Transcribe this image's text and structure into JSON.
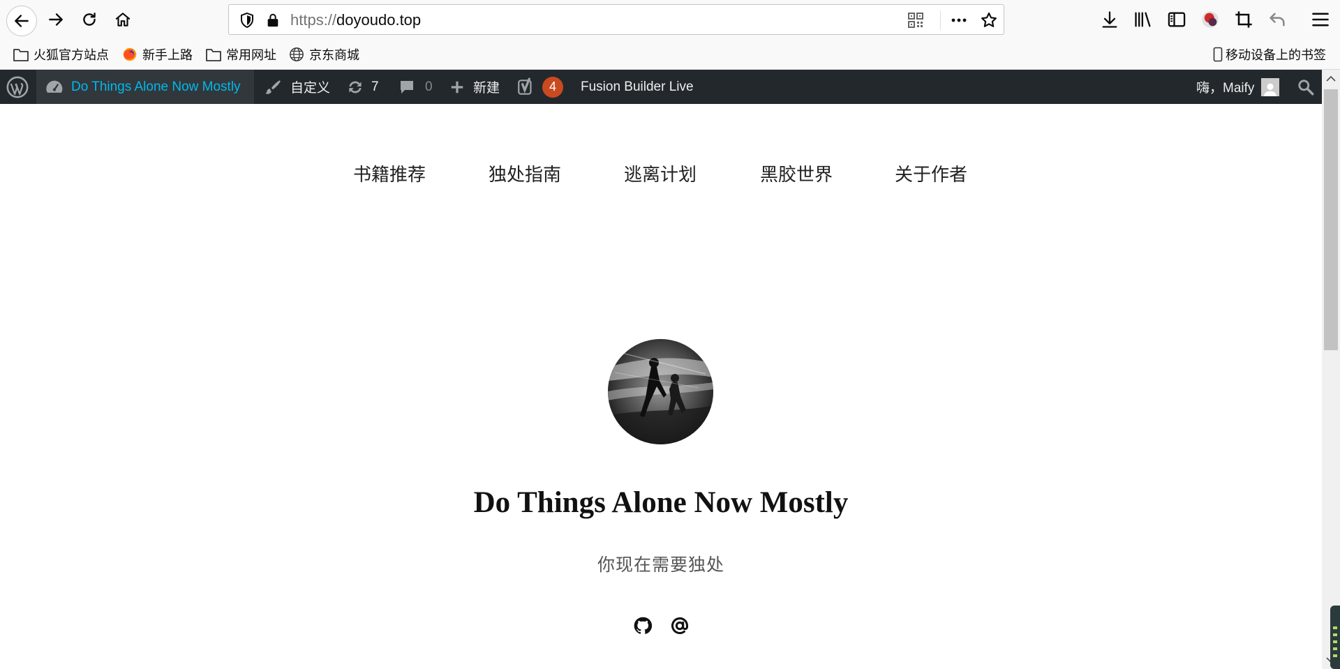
{
  "browser": {
    "url_scheme": "https://",
    "url_host": "doyoudo.top",
    "icons": [
      "back-icon",
      "forward-icon",
      "reload-icon",
      "home-icon",
      "shield-icon",
      "lock-icon",
      "qr-code-icon",
      "more-icon",
      "star-icon",
      "download-icon",
      "library-icon",
      "sidebar-icon",
      "profile-icon",
      "screenshot-icon",
      "undo-icon",
      "menu-icon"
    ]
  },
  "bookmarks": {
    "items": [
      {
        "label": "火狐官方站点",
        "icon": "folder-icon"
      },
      {
        "label": "新手上路",
        "icon": "firefox-icon"
      },
      {
        "label": "常用网址",
        "icon": "folder-icon"
      },
      {
        "label": "京东商城",
        "icon": "globe-icon"
      }
    ],
    "mobile_label": "移动设备上的书签"
  },
  "adminbar": {
    "site_name": "Do Things Alone Now Mostly",
    "customize": "自定义",
    "updates_count": "7",
    "comments_count": "0",
    "new_label": "新建",
    "yoast_badge": "4",
    "fusion_label": "Fusion Builder Live",
    "greeting": "嗨，Maify"
  },
  "site": {
    "nav": [
      "书籍推荐",
      "独处指南",
      "逃离计划",
      "黑胶世界",
      "关于作者"
    ],
    "title": "Do Things Alone Now Mostly",
    "description": "你现在需要独处",
    "social": [
      "github-icon",
      "at-icon"
    ]
  },
  "colors": {
    "adminbar_bg": "#23282d",
    "adminbar_site_bg": "#32373c",
    "adminbar_link": "#00b9eb",
    "badge": "#ca4a1f"
  }
}
